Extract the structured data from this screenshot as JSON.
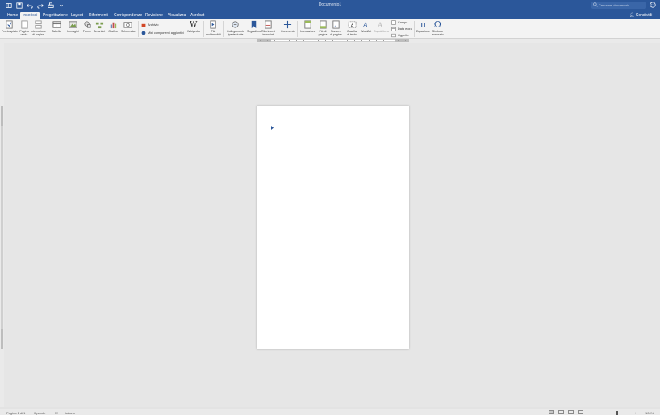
{
  "window": {
    "title": "Documento1"
  },
  "search": {
    "placeholder": "Cerca nel documento"
  },
  "tabs": [
    {
      "label": "Home"
    },
    {
      "label": "Inserisci"
    },
    {
      "label": "Progettazione"
    },
    {
      "label": "Layout"
    },
    {
      "label": "Riferimenti"
    },
    {
      "label": "Corrispondenze"
    },
    {
      "label": "Revisione"
    },
    {
      "label": "Visualizza"
    },
    {
      "label": "Acrobat"
    }
  ],
  "share": {
    "label": "Condividi"
  },
  "ribbon": {
    "frontespizio": "Frontespizio",
    "pagina_vuota": "Pagina\nvuota",
    "interruzione": "Interruzione\ndi pagina",
    "tabella": "Tabella",
    "immagini": "Immagini",
    "forme": "Forme",
    "smartart": "SmartArt",
    "grafico": "Grafico",
    "schermata": "Schermata",
    "archivio": "Archivio",
    "componenti": "Miei componenti aggiuntivi",
    "wikipedia": "Wikipedia",
    "file_multimediali": "File\nmultimediali",
    "collegamento": "Collegamento\nipertestuale",
    "segnalibro": "Segnalibro",
    "riferimenti_incrociati": "Riferimenti\nincrociati",
    "commento": "Commento",
    "intestazione": "Intestazione",
    "pie_di_pagina": "Piè di\npagina",
    "numero_pagina": "Numero\ndi pagina",
    "casella_testo": "Casella\ndi testo",
    "wordart": "WordArt",
    "capolettera": "Capolettera",
    "campo": "Campo",
    "data_ora": "Data e ora",
    "oggetto": "Oggetto",
    "equazione": "Equazione",
    "simbolo_avanzato": "Simbolo\navanzato"
  },
  "status": {
    "page": "Pagina 1 di 1",
    "words": "0 parole",
    "language": "Italiano",
    "zoom": "100%"
  },
  "colors": {
    "titlebar": "#2b579a",
    "ribbon": "#f3f3f3",
    "canvas": "#e6e6e6"
  }
}
